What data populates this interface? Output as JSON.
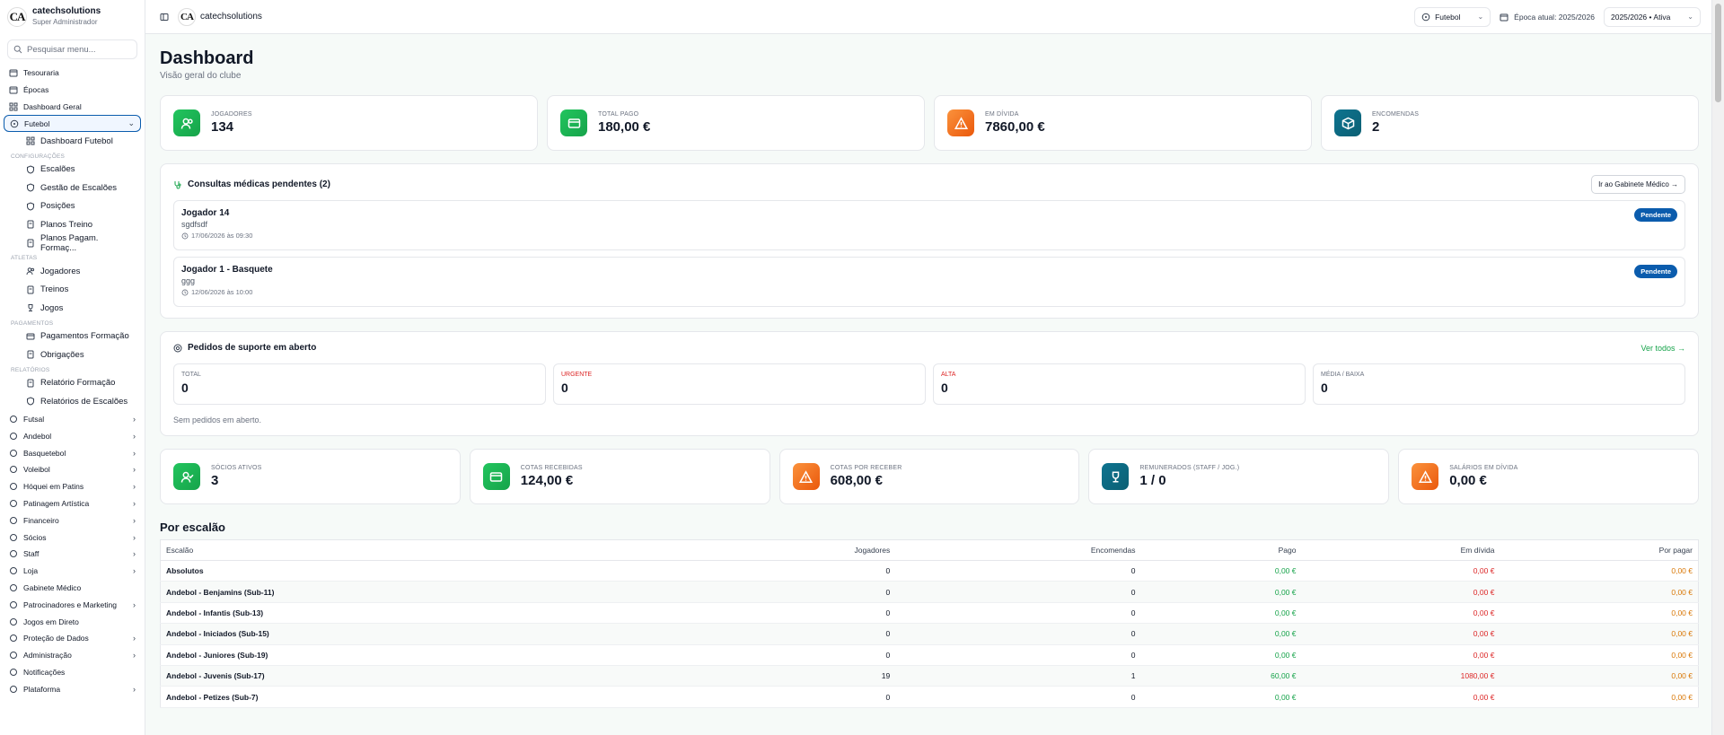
{
  "sidebar": {
    "org_name": "catechsolutions",
    "role": "Super Administrador",
    "logo_text": "CA",
    "search_placeholder": "Pesquisar menu...",
    "top_items": [
      {
        "label": "Tesouraria",
        "icon": "calendar-icon"
      },
      {
        "label": "Épocas",
        "icon": "calendar-icon"
      },
      {
        "label": "Dashboard Geral",
        "icon": "grid-icon"
      }
    ],
    "active_item": {
      "label": "Futebol",
      "icon": "ball-icon"
    },
    "futebol_dashboard": "Dashboard Futebol",
    "sections": [
      {
        "title": "CONFIGURAÇÕES",
        "items": [
          "Escalões",
          "Gestão de Escalões",
          "Posições",
          "Planos Treino",
          "Planos Pagam. Formaç..."
        ]
      },
      {
        "title": "ATLETAS",
        "items": [
          "Jogadores",
          "Treinos",
          "Jogos"
        ]
      },
      {
        "title": "PAGAMENTOS",
        "items": [
          "Pagamentos Formação",
          "Obrigações"
        ]
      },
      {
        "title": "RELATÓRIOS",
        "items": [
          "Relatório Formação",
          "Relatórios de Escalões"
        ]
      }
    ],
    "bottom_items": [
      {
        "label": "Futsal",
        "chevron": true
      },
      {
        "label": "Andebol",
        "chevron": true
      },
      {
        "label": "Basquetebol",
        "chevron": true
      },
      {
        "label": "Voleibol",
        "chevron": true
      },
      {
        "label": "Hóquei em Patins",
        "chevron": true
      },
      {
        "label": "Patinagem Artística",
        "chevron": true
      },
      {
        "label": "Financeiro",
        "chevron": true
      },
      {
        "label": "Sócios",
        "chevron": true
      },
      {
        "label": "Staff",
        "chevron": true
      },
      {
        "label": "Loja",
        "chevron": true
      },
      {
        "label": "Gabinete Médico",
        "chevron": false
      },
      {
        "label": "Patrocinadores e Marketing",
        "chevron": true
      },
      {
        "label": "Jogos em Direto",
        "chevron": false
      },
      {
        "label": "Proteção de Dados",
        "chevron": true
      },
      {
        "label": "Administração",
        "chevron": true
      },
      {
        "label": "Notificações",
        "chevron": false
      },
      {
        "label": "Plataforma",
        "chevron": true
      }
    ]
  },
  "topbar": {
    "org_name": "catechsolutions",
    "sport_select": "Futebol",
    "season_label": "Época atual: 2025/2026",
    "season_select": "2025/2026 • Ativa"
  },
  "page": {
    "title": "Dashboard",
    "subtitle": "Visão geral do clube"
  },
  "stats_top": [
    {
      "label": "JOGADORES",
      "value": "134",
      "color": "#16a34a",
      "icon": "users-icon"
    },
    {
      "label": "TOTAL PAGO",
      "value": "180,00 €",
      "color": "#16a34a",
      "icon": "card-icon"
    },
    {
      "label": "EM DÍVIDA",
      "value": "7860,00 €",
      "color": "#ea580c",
      "icon": "warning-icon"
    },
    {
      "label": "ENCOMENDAS",
      "value": "2",
      "color": "#0e7490",
      "icon": "box-icon"
    }
  ],
  "consultas": {
    "title": "Consultas médicas pendentes (2)",
    "button": "Ir ao Gabinete Médico →",
    "items": [
      {
        "name": "Jogador 14",
        "desc": "sgdfsdf",
        "date": "17/06/2026 às 09:30",
        "status": "Pendente"
      },
      {
        "name": "Jogador 1 - Basquete",
        "desc": "ggg",
        "date": "12/06/2026 às 10:00",
        "status": "Pendente"
      }
    ]
  },
  "suporte": {
    "title": "Pedidos de suporte em aberto",
    "link": "Ver todos →",
    "boxes": [
      {
        "label": "TOTAL",
        "value": "0",
        "red": false
      },
      {
        "label": "URGENTE",
        "value": "0",
        "red": true
      },
      {
        "label": "ALTA",
        "value": "0",
        "red": true
      },
      {
        "label": "MÉDIA / BAIXA",
        "value": "0",
        "red": false
      }
    ],
    "empty": "Sem pedidos em aberto."
  },
  "stats_bottom": [
    {
      "label": "SÓCIOS ATIVOS",
      "value": "3",
      "icon": "user-check-icon"
    },
    {
      "label": "COTAS RECEBIDAS",
      "value": "124,00 €",
      "icon": "card-icon"
    },
    {
      "label": "COTAS POR RECEBER",
      "value": "608,00 €",
      "icon": "warning-icon"
    },
    {
      "label": "REMUNERADOS (STAFF / JOG.)",
      "value": "1 / 0",
      "icon": "trophy-icon"
    },
    {
      "label": "SALÁRIOS EM DÍVIDA",
      "value": "0,00 €",
      "icon": "warning-icon"
    }
  ],
  "escalao": {
    "title": "Por escalão",
    "columns": [
      "Escalão",
      "Jogadores",
      "Encomendas",
      "Pago",
      "Em dívida",
      "Por pagar"
    ],
    "rows": [
      [
        "Absolutos",
        "0",
        "0",
        "0,00 €",
        "0,00 €",
        "0,00 €"
      ],
      [
        "Andebol - Benjamins (Sub-11)",
        "0",
        "0",
        "0,00 €",
        "0,00 €",
        "0,00 €"
      ],
      [
        "Andebol - Infantis (Sub-13)",
        "0",
        "0",
        "0,00 €",
        "0,00 €",
        "0,00 €"
      ],
      [
        "Andebol - Iniciados (Sub-15)",
        "0",
        "0",
        "0,00 €",
        "0,00 €",
        "0,00 €"
      ],
      [
        "Andebol - Juniores (Sub-19)",
        "0",
        "0",
        "0,00 €",
        "0,00 €",
        "0,00 €"
      ],
      [
        "Andebol - Juvenis (Sub-17)",
        "19",
        "1",
        "60,00 €",
        "1080,00 €",
        "0,00 €"
      ],
      [
        "Andebol - Petizes (Sub-7)",
        "0",
        "0",
        "0,00 €",
        "0,00 €",
        "0,00 €"
      ]
    ]
  }
}
